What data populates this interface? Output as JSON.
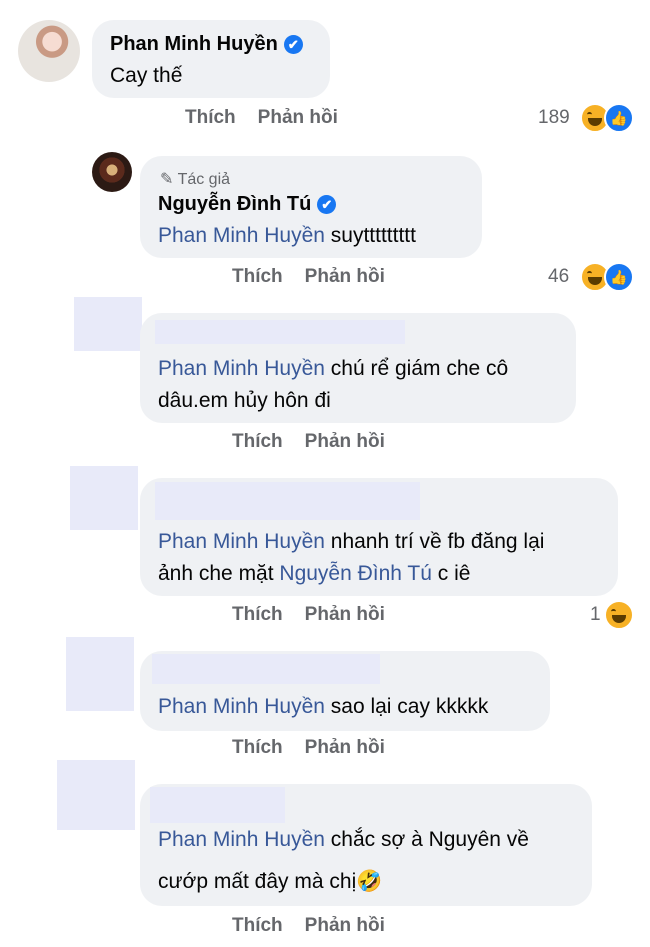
{
  "actions": {
    "like": "Thích",
    "reply": "Phản hồi"
  },
  "icons": {
    "verified": "✔",
    "like_thumb": "👍",
    "pencil": "✎",
    "laugh_emoji": "🤣"
  },
  "comments": [
    {
      "author": "Phan Minh Huyền",
      "verified": true,
      "text": "Cay thế",
      "reaction_count": "189"
    },
    {
      "author_badge": "Tác giả",
      "author": "Nguyễn Đình Tú",
      "verified": true,
      "mention": "Phan Minh Huyền",
      "text": " suyttttttttt",
      "reaction_count": "46"
    },
    {
      "mention": "Phan Minh Huyền",
      "line1": " chú rể giám che cô",
      "line2": "dâu.em hủy hôn đi"
    },
    {
      "mention": "Phan Minh Huyền",
      "line1": " nhanh trí về fb đăng lại",
      "line2_prefix": "ảnh che mặt ",
      "line2_mention": "Nguyễn Đình Tú",
      "line2_suffix": " c iê",
      "reaction_count": "1"
    },
    {
      "mention": "Phan Minh Huyền",
      "text": " sao lại cay kkkkk"
    },
    {
      "mention": "Phan Minh Huyền",
      "line1": " chắc sợ à Nguyên về",
      "line2": "cướp mất đây mà chị"
    }
  ]
}
